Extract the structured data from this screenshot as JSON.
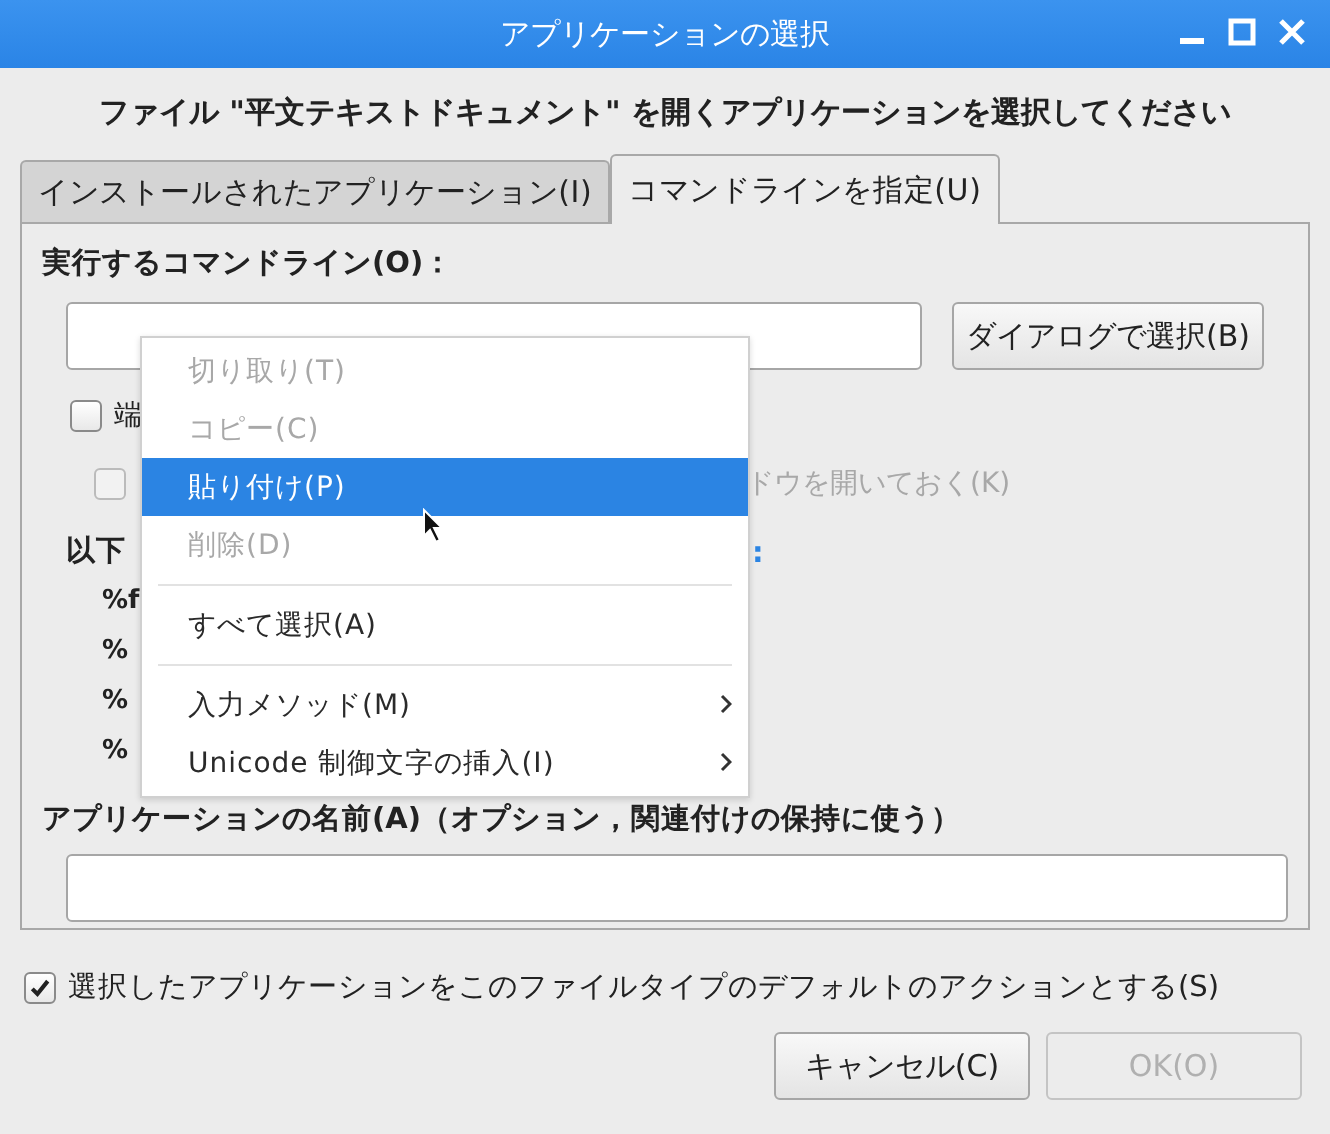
{
  "window": {
    "title": "アプリケーションの選択"
  },
  "heading": "ファイル \"平文テキストドキュメント\" を開くアプリケーションを選択してください",
  "tabs": [
    {
      "label": "インストールされたアプリケーション(I)",
      "selected": false
    },
    {
      "label": "コマンドラインを指定(U)",
      "selected": true
    }
  ],
  "command": {
    "label": "実行するコマンドライン(O)：",
    "browse_button": "ダイアログで選択(B)"
  },
  "options": [
    {
      "label": "端",
      "checked": false,
      "disabled": false
    },
    {
      "label": "ドウを開いておく(K)",
      "checked": false,
      "disabled": true
    }
  ],
  "codes": {
    "label": "以下",
    "label_tail": ":",
    "items": [
      "%f",
      "%",
      "%",
      "%"
    ]
  },
  "app_name": {
    "label": "アプリケーションの名前(A)（オプション，関連付けの保持に使う）"
  },
  "default_action": {
    "label": "選択したアプリケーションをこのファイルタイプのデフォルトのアクションとする(S)",
    "checked": true
  },
  "buttons": [
    {
      "label": "キャンセル(C)",
      "disabled": false
    },
    {
      "label": "OK(O)",
      "disabled": true
    }
  ],
  "context_menu": {
    "items": [
      {
        "kind": "item",
        "label": "切り取り(T)",
        "disabled": true,
        "selected": false,
        "submenu": false
      },
      {
        "kind": "item",
        "label": "コピー(C)",
        "disabled": true,
        "selected": false,
        "submenu": false
      },
      {
        "kind": "item",
        "label": "貼り付け(P)",
        "disabled": false,
        "selected": true,
        "submenu": false
      },
      {
        "kind": "item",
        "label": "削除(D)",
        "disabled": true,
        "selected": false,
        "submenu": false
      },
      {
        "kind": "separator"
      },
      {
        "kind": "item",
        "label": "すべて選択(A)",
        "disabled": false,
        "selected": false,
        "submenu": false
      },
      {
        "kind": "separator"
      },
      {
        "kind": "item",
        "label": "入力メソッド(M)",
        "disabled": false,
        "selected": false,
        "submenu": true
      },
      {
        "kind": "item",
        "label": "Unicode 制御文字の挿入(I)",
        "disabled": false,
        "selected": false,
        "submenu": true
      }
    ]
  }
}
